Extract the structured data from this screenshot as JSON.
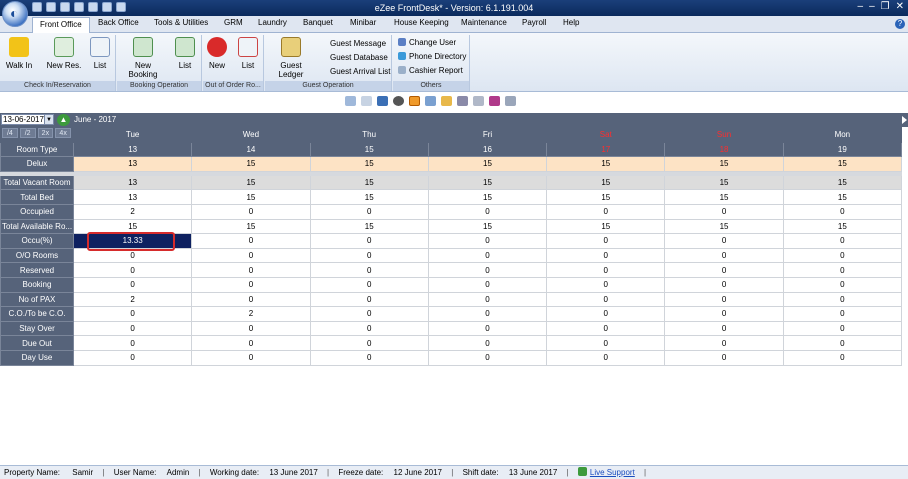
{
  "window": {
    "title": "eZee FrontDesk* - Version: 6.1.191.004",
    "controls": [
      "‒",
      "‒",
      "❐",
      "✕"
    ]
  },
  "menu_tabs": [
    "Front Office",
    "Back Office",
    "Tools & Utilities",
    "GRM",
    "Laundry",
    "Banquet",
    "Minibar",
    "House Keeping",
    "Maintenance",
    "Payroll",
    "Help"
  ],
  "ribbon": {
    "checkin": {
      "label": "Check In/Reservation",
      "walkin": "Walk In",
      "newres": "New Res.",
      "list": "List"
    },
    "booking": {
      "label": "Booking Operation",
      "newbooking": "New Booking",
      "list": "List"
    },
    "ooo": {
      "label": "Out of Order Ro...",
      "new": "New",
      "list": "List"
    },
    "guest": {
      "label": "Guest Operation",
      "ledger": "Guest Ledger",
      "message": "Guest Message",
      "database": "Guest Database",
      "arrival": "Guest Arrival List"
    },
    "others": {
      "label": "Others",
      "changeuser": "Change User",
      "phone": "Phone Directory",
      "cashier": "Cashier Report"
    }
  },
  "calendar": {
    "date_value": "13-06-2017",
    "month_label": "June - 2017",
    "zoom": [
      "/4",
      "/2",
      "2x",
      "4x"
    ],
    "days": [
      "Tue",
      "Wed",
      "Thu",
      "Fri",
      "Sat",
      "Sun",
      "Mon"
    ],
    "dates": [
      "13",
      "14",
      "15",
      "16",
      "17",
      "18",
      "19"
    ],
    "weekend_color": "#ff2d2d",
    "room_type_label": "Room Type",
    "room_types": [
      {
        "name": "Delux",
        "values": [
          "13",
          "15",
          "15",
          "15",
          "15",
          "15",
          "15"
        ]
      }
    ]
  },
  "stats": [
    {
      "label": "Total Vacant Room",
      "values": [
        "13",
        "15",
        "15",
        "15",
        "15",
        "15",
        "15"
      ]
    },
    {
      "label": "Total Bed",
      "values": [
        "13",
        "15",
        "15",
        "15",
        "15",
        "15",
        "15"
      ]
    },
    {
      "label": "Occupied",
      "values": [
        "2",
        "0",
        "0",
        "0",
        "0",
        "0",
        "0"
      ]
    },
    {
      "label": "Total Available Ro...",
      "values": [
        "15",
        "15",
        "15",
        "15",
        "15",
        "15",
        "15"
      ]
    },
    {
      "label": "Occu(%)",
      "values": [
        "13.33",
        "0",
        "0",
        "0",
        "0",
        "0",
        "0"
      ]
    },
    {
      "label": "O/O Rooms",
      "values": [
        "0",
        "0",
        "0",
        "0",
        "0",
        "0",
        "0"
      ]
    },
    {
      "label": "Reserved",
      "values": [
        "0",
        "0",
        "0",
        "0",
        "0",
        "0",
        "0"
      ]
    },
    {
      "label": "Booking",
      "values": [
        "0",
        "0",
        "0",
        "0",
        "0",
        "0",
        "0"
      ]
    },
    {
      "label": "No of PAX",
      "values": [
        "2",
        "0",
        "0",
        "0",
        "0",
        "0",
        "0"
      ]
    },
    {
      "label": "C.O./To be C.O.",
      "values": [
        "0",
        "2",
        "0",
        "0",
        "0",
        "0",
        "0"
      ]
    },
    {
      "label": "Stay Over",
      "values": [
        "0",
        "0",
        "0",
        "0",
        "0",
        "0",
        "0"
      ]
    },
    {
      "label": "Due Out",
      "values": [
        "0",
        "0",
        "0",
        "0",
        "0",
        "0",
        "0"
      ]
    },
    {
      "label": "Day Use",
      "values": [
        "0",
        "0",
        "0",
        "0",
        "0",
        "0",
        "0"
      ]
    }
  ],
  "status": {
    "property_label": "Property Name:",
    "property": "Samir",
    "user_label": "User Name:",
    "user": "Admin",
    "working_label": "Working date:",
    "working": "13 June 2017",
    "freeze_label": "Freeze date:",
    "freeze": "12 June 2017",
    "shift_label": "Shift date:",
    "shift": "13 June 2017",
    "live": "Live Support"
  }
}
